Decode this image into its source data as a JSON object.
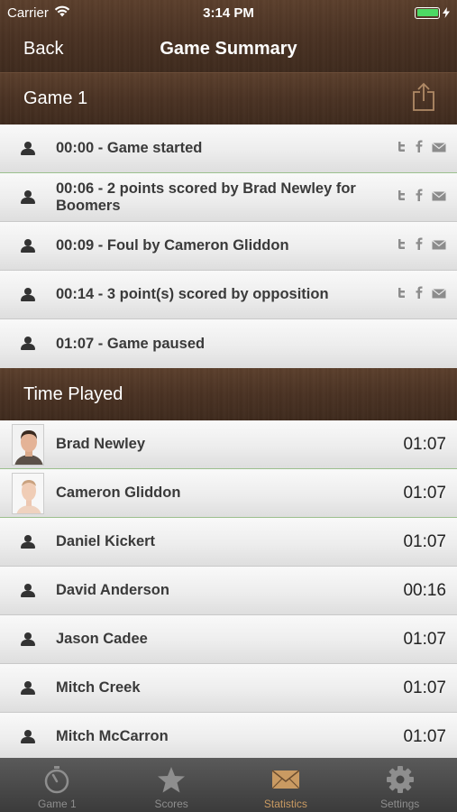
{
  "status_bar": {
    "carrier": "Carrier",
    "time": "3:14 PM"
  },
  "nav": {
    "back_label": "Back",
    "title": "Game Summary"
  },
  "game_section": {
    "title": "Game 1",
    "events": [
      {
        "text": "00:00 - Game started",
        "share": true
      },
      {
        "text": "00:06 - 2 points scored by Brad Newley for Boomers",
        "share": true
      },
      {
        "text": "00:09 - Foul by Cameron Gliddon",
        "share": true
      },
      {
        "text": "00:14 - 3 point(s) scored by opposition",
        "share": true
      },
      {
        "text": "01:07 - Game paused",
        "share": false
      }
    ]
  },
  "time_played_section": {
    "title": "Time Played",
    "players": [
      {
        "name": "Brad Newley",
        "time": "01:07",
        "avatar": "photo-male"
      },
      {
        "name": "Cameron Gliddon",
        "time": "01:07",
        "avatar": "photo-female"
      },
      {
        "name": "Daniel Kickert",
        "time": "01:07",
        "avatar": "person-icon"
      },
      {
        "name": "David Anderson",
        "time": "00:16",
        "avatar": "person-icon"
      },
      {
        "name": "Jason Cadee",
        "time": "01:07",
        "avatar": "person-icon"
      },
      {
        "name": "Mitch Creek",
        "time": "01:07",
        "avatar": "person-icon"
      },
      {
        "name": "Mitch McCarron",
        "time": "01:07",
        "avatar": "person-icon"
      }
    ]
  },
  "tab_bar": {
    "tabs": [
      {
        "label": "Game 1",
        "icon": "stopwatch-icon",
        "active": false
      },
      {
        "label": "Scores",
        "icon": "star-icon",
        "active": false
      },
      {
        "label": "Statistics",
        "icon": "envelope-icon",
        "active": true
      },
      {
        "label": "Settings",
        "icon": "gear-icon",
        "active": false
      }
    ]
  },
  "colors": {
    "accent_active_tab": "#c99a62",
    "battery": "#4cd964",
    "wood": "#4a3223"
  }
}
